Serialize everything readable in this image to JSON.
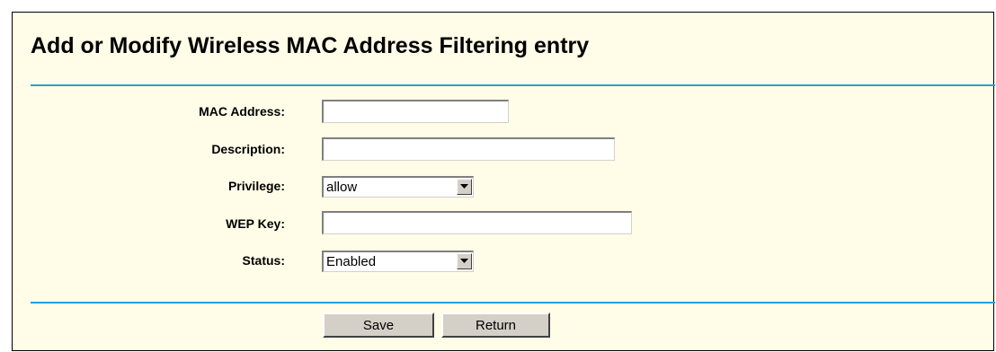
{
  "page": {
    "title": "Add or Modify Wireless MAC Address Filtering entry"
  },
  "form": {
    "mac_address": {
      "label": "MAC Address:",
      "value": ""
    },
    "description": {
      "label": "Description:",
      "value": ""
    },
    "privilege": {
      "label": "Privilege:",
      "value": "allow",
      "control": "dropdown"
    },
    "wep_key": {
      "label": "WEP Key:",
      "value": ""
    },
    "status": {
      "label": "Status:",
      "value": "Enabled",
      "control": "dropdown"
    }
  },
  "buttons": {
    "save_label": "Save",
    "return_label": "Return"
  },
  "icons": {
    "dropdown_arrow": "chevron-down-icon"
  },
  "colors": {
    "panel_background": "#fffde8",
    "rule": "#1f9fd9",
    "button_face": "#d4d0c8"
  }
}
